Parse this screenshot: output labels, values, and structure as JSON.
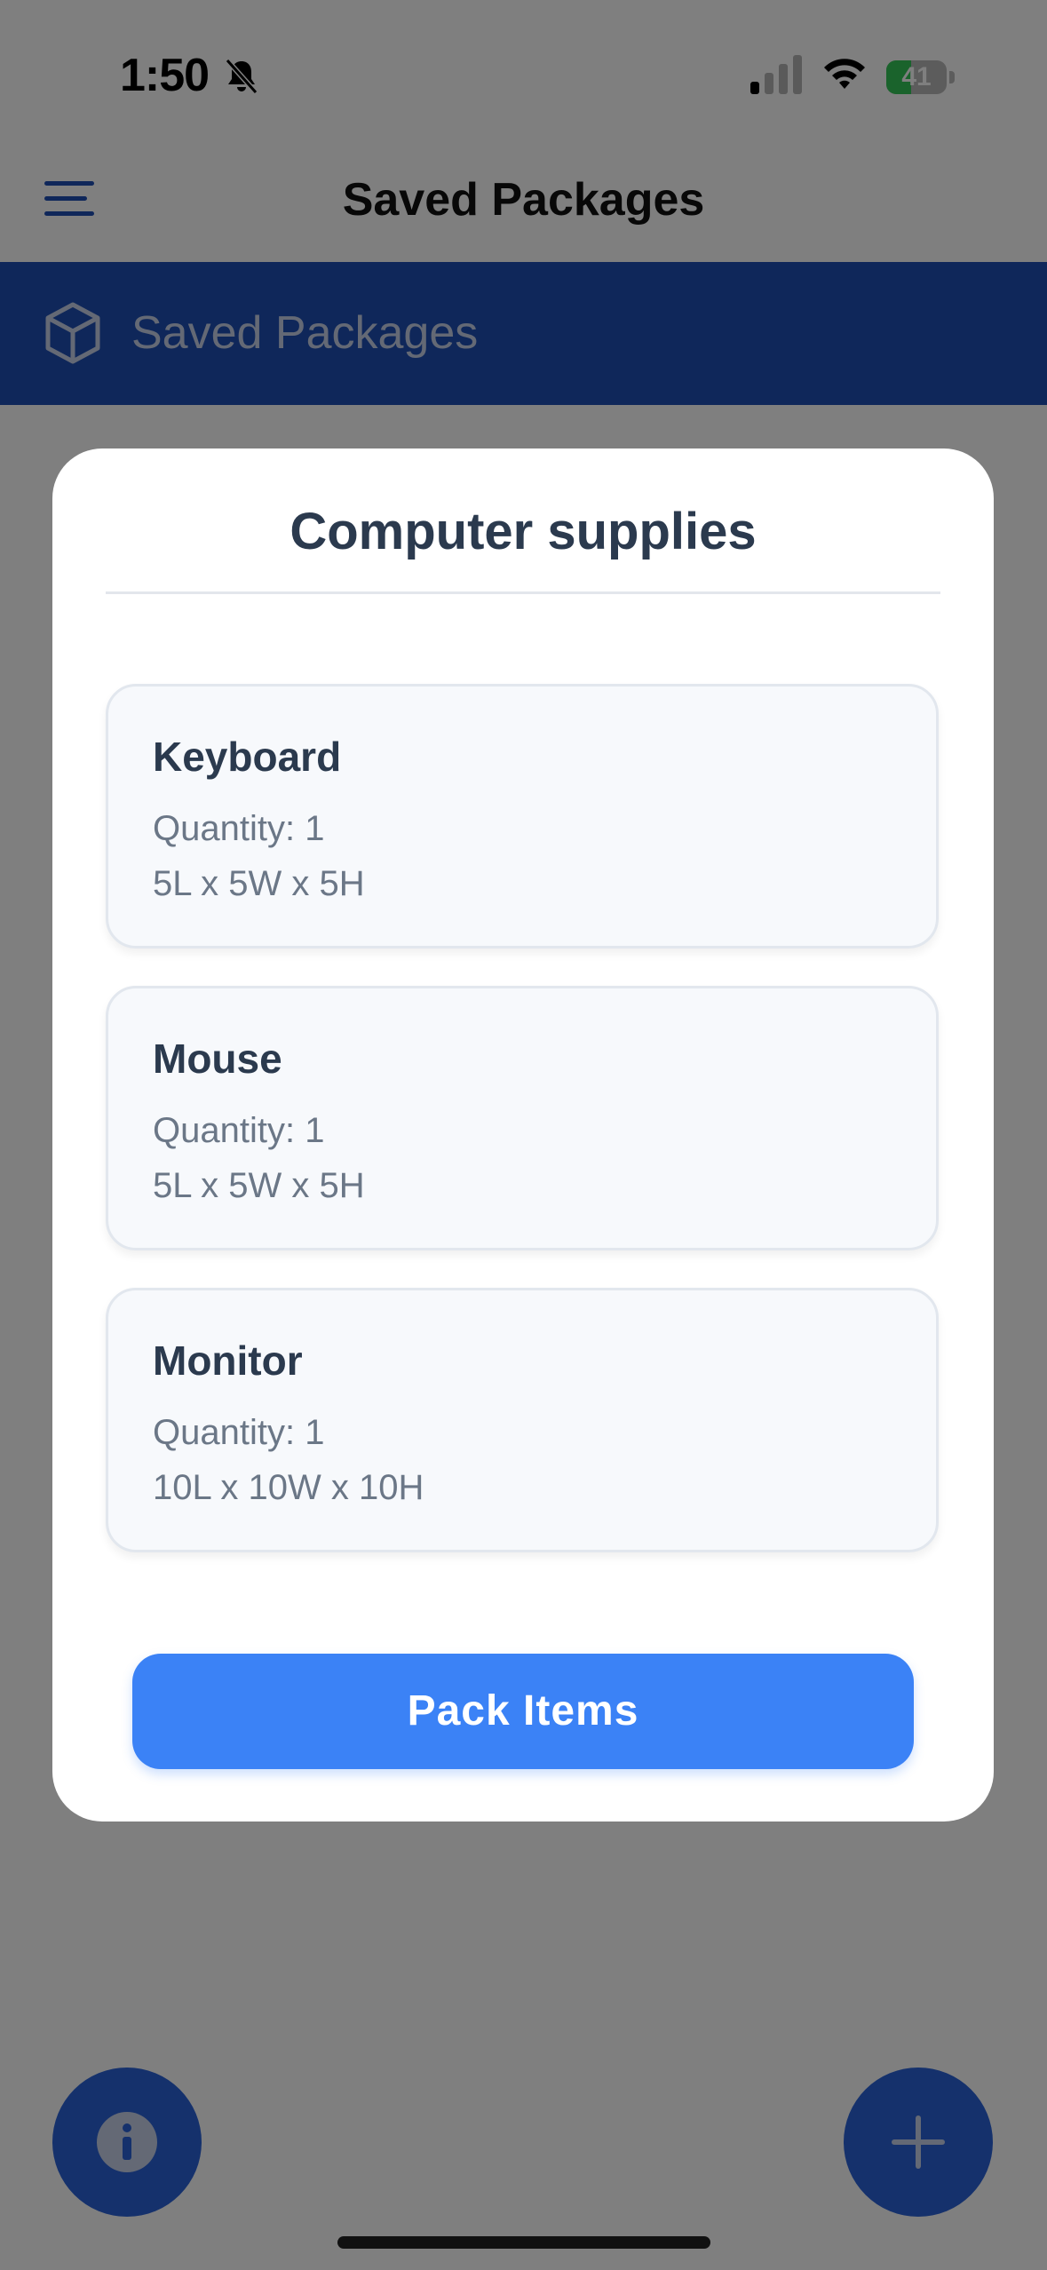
{
  "status_bar": {
    "time": "1:50",
    "battery_level": "41",
    "battery_fraction": 0.41,
    "icons": [
      "bell-slash-icon",
      "cellular-signal-icon",
      "wifi-icon",
      "battery-charging-icon"
    ]
  },
  "nav": {
    "title": "Saved Packages",
    "menu_icon": "hamburger-menu-icon"
  },
  "section": {
    "title": "Saved Packages",
    "icon": "cube-icon"
  },
  "modal": {
    "title": "Computer supplies",
    "items": [
      {
        "name": "Keyboard",
        "quantity": "Quantity: 1",
        "dimensions": "5L x 5W x 5H"
      },
      {
        "name": "Mouse",
        "quantity": "Quantity: 1",
        "dimensions": "5L x 5W x 5H"
      },
      {
        "name": "Monitor",
        "quantity": "Quantity: 1",
        "dimensions": "10L x 10W x 10H"
      }
    ],
    "pack_button": "Pack Items"
  },
  "fabs": {
    "info_icon": "info-icon",
    "add_icon": "plus-icon"
  },
  "colors": {
    "primary_dark": "#1f4fb5",
    "primary": "#3b82f6",
    "battery_green": "#34c759",
    "text_dark": "#2b3a4e",
    "text_muted": "#6b7787"
  }
}
